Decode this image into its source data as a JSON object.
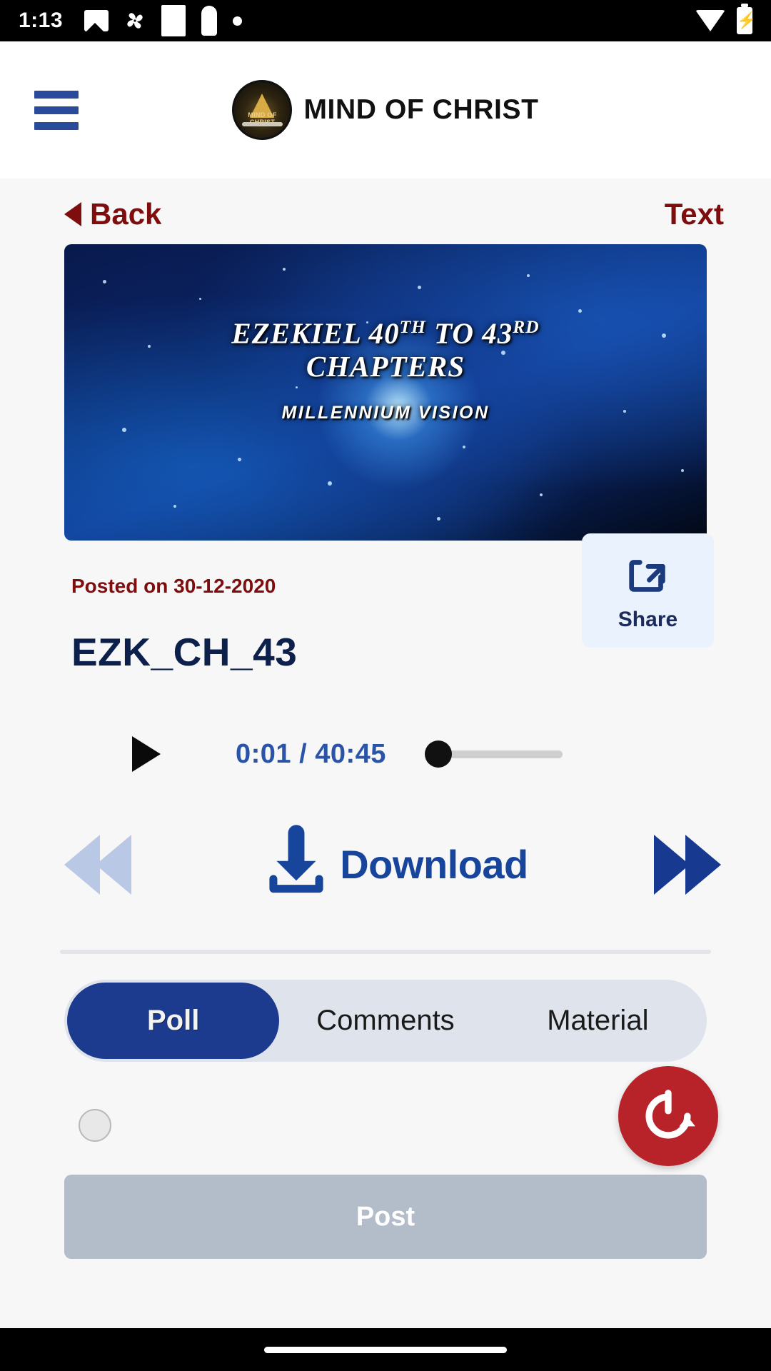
{
  "status_bar": {
    "time": "1:13",
    "icons": [
      "photo-icon",
      "pinwheel-icon",
      "square-icon",
      "key-icon",
      "dot-icon"
    ],
    "right_icons": [
      "wifi-icon",
      "battery-charging-icon"
    ]
  },
  "header": {
    "menu_icon": "hamburger-menu-icon",
    "logo_text": "MIND OF CHRIST",
    "brand_name": "MIND OF CHRIST",
    "menu_color": "#2a4b9b"
  },
  "nav": {
    "back_label": "Back",
    "back_icon": "caret-left-icon",
    "text_link_label": "Text",
    "accent_color": "#7e0d0d"
  },
  "video": {
    "title_line1_a": "EZEKIEL 40",
    "title_line1_sup1": "TH",
    "title_line1_b": " TO 43",
    "title_line1_sup2": "RD",
    "title_line2": "CHAPTERS",
    "subtitle": "MILLENNIUM VISION"
  },
  "meta": {
    "posted_label": "Posted on 30-12-2020",
    "file_title": "EZK_CH_43",
    "share_label": "Share",
    "share_icon": "share-box-arrow-icon",
    "title_color": "#0d1f4b"
  },
  "player": {
    "play_icon": "play-triangle-icon",
    "timecode": "0:01 / 40:45",
    "current_time": "0:01",
    "duration": "40:45",
    "progress_percent": 0,
    "timecode_color": "#2a54a8"
  },
  "transport": {
    "rewind_icon": "rewind-double-arrow-icon",
    "forward_icon": "fast-forward-double-arrow-icon",
    "download_label": "Download",
    "download_icon": "download-tray-icon",
    "download_color": "#18459c",
    "rewind_disabled_color": "#b9c8e4"
  },
  "tabs": [
    {
      "label": "Poll",
      "active": true
    },
    {
      "label": "Comments",
      "active": false
    },
    {
      "label": "Material",
      "active": false
    }
  ],
  "poll": {
    "radio_icon": "radio-button-unchecked-icon",
    "refresh_icon": "refresh-circle-icon",
    "refresh_color": "#b8232a",
    "post_label": "Post"
  },
  "navbar": {
    "home_indicator": "home-indicator-pill"
  }
}
